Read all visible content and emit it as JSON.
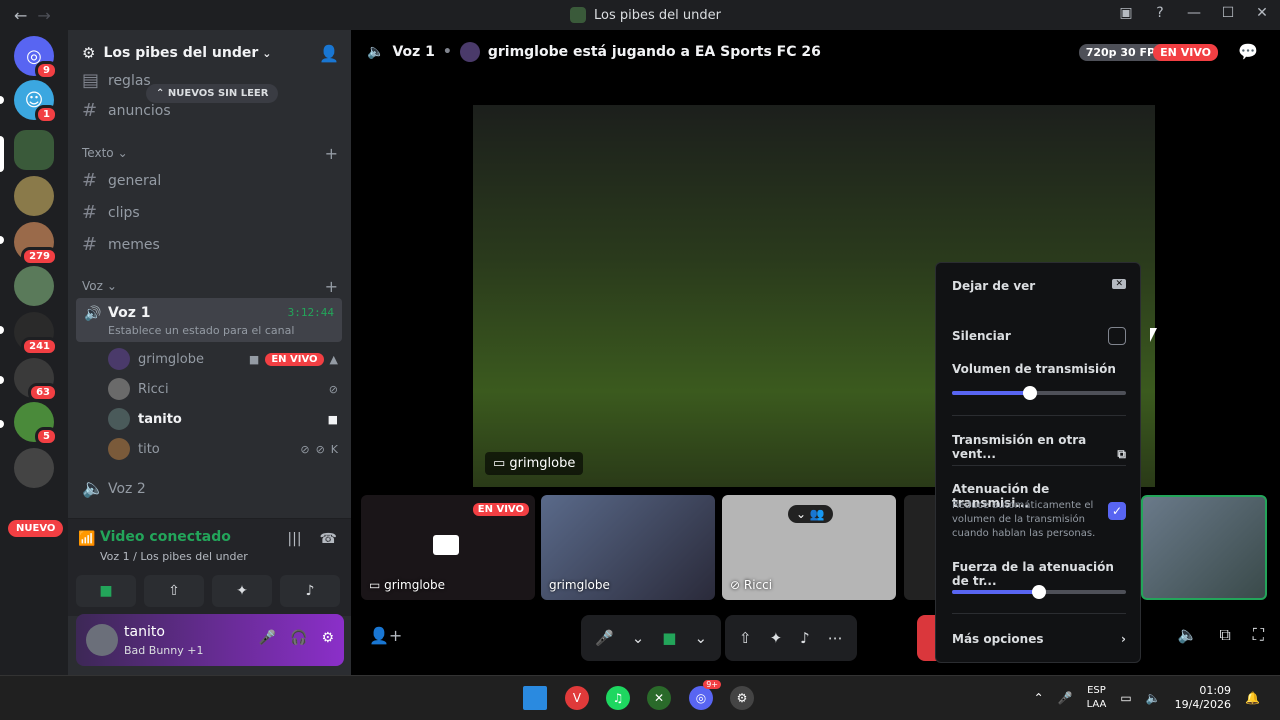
{
  "window": {
    "title": "Los pibes del under"
  },
  "guilds": {
    "badges": [
      "9",
      "1",
      "279",
      "241",
      "63",
      "5"
    ],
    "new_label": "NUEVO"
  },
  "server": {
    "name": "Los pibes del under"
  },
  "channels": {
    "top": [
      "reglas",
      "anuncios"
    ],
    "new_unread": "NUEVOS SIN LEER",
    "text_category": "Texto",
    "text": [
      "general",
      "clips",
      "memes"
    ],
    "voice_category": "Voz",
    "active_voice": {
      "name": "Voz 1",
      "timer": "3:12:44",
      "status": "Establece un estado para el canal"
    },
    "voice_users": [
      {
        "name": "grimglobe",
        "live": "EN VIVO"
      },
      {
        "name": "Ricci"
      },
      {
        "name": "tanito"
      },
      {
        "name": "tito"
      }
    ],
    "voice2": "Voz 2"
  },
  "voice_panel": {
    "status": "Video conectado",
    "sub": "Voz 1 / Los pibes del under"
  },
  "user": {
    "name": "tanito",
    "activity": "Bad Bunny +1"
  },
  "stage": {
    "channel": "Voz 1",
    "activity": "grimglobe está jugando a EA Sports FC 26",
    "quality": "720p 30 FPS",
    "live": "EN VIVO",
    "main_tag": "grimglobe",
    "tiles": [
      {
        "name": "grimglobe",
        "live": "EN VIVO"
      },
      {
        "name": "grimglobe"
      },
      {
        "name": "Ricci"
      }
    ]
  },
  "menu": {
    "stop_watching": "Dejar de ver",
    "mute": "Silenciar",
    "volume_label": "Volumen de transmisión",
    "volume": 0.45,
    "popout": "Transmisión en otra vent...",
    "attenuation": "Atenuación de transmisi...",
    "attenuation_desc": "Reduce automáticamente el volumen de la transmisión cuando hablan las personas.",
    "strength_label": "Fuerza de la atenuación de tr...",
    "strength": 0.5,
    "more": "Más opciones"
  },
  "taskbar": {
    "lang1": "ESP",
    "lang2": "LAA",
    "time": "01:09",
    "date": "19/4/2026",
    "discord_badge": "9+"
  },
  "colors": {
    "accent": "#5865f2",
    "green": "#23a55a",
    "red": "#f23f43"
  }
}
